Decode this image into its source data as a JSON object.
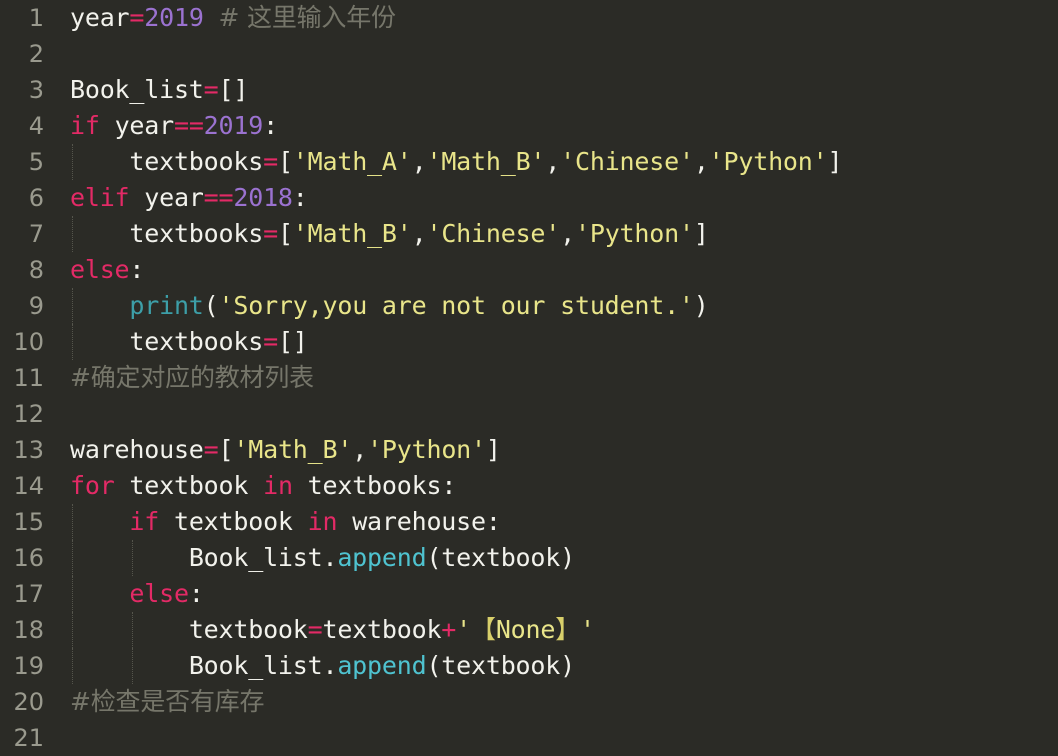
{
  "editor": {
    "language": "Python",
    "theme": "dark-olive",
    "colors": {
      "background": "#2b2b26",
      "foreground": "#f2f2ec",
      "gutter_text": "#9a9a8e",
      "keyword": "#e32a66",
      "operator": "#e32a66",
      "number": "#9b72d0",
      "string": "#e9e58a",
      "builtin_function": "#4fc3d0",
      "comment": "#76766a",
      "indent_guide": "#55554c",
      "fullwidth_bracket": "#d8cf6a"
    },
    "first_visible_line": 1,
    "last_visible_line": 21,
    "total_visible_lines": 21
  },
  "lines": [
    {
      "number": "1",
      "guides": 0,
      "text": "year=2019 # 这里输入年份"
    },
    {
      "number": "2",
      "guides": 0,
      "text": ""
    },
    {
      "number": "3",
      "guides": 0,
      "text": "Book_list=[]"
    },
    {
      "number": "4",
      "guides": 0,
      "text": "if year==2019:"
    },
    {
      "number": "5",
      "guides": 1,
      "text": "    textbooks=['Math_A','Math_B','Chinese','Python']"
    },
    {
      "number": "6",
      "guides": 0,
      "text": "elif year==2018:"
    },
    {
      "number": "7",
      "guides": 1,
      "text": "    textbooks=['Math_B','Chinese','Python']"
    },
    {
      "number": "8",
      "guides": 0,
      "text": "else:"
    },
    {
      "number": "9",
      "guides": 1,
      "text": "    print('Sorry,you are not our student.')"
    },
    {
      "number": "10",
      "guides": 1,
      "text": "    textbooks=[]"
    },
    {
      "number": "11",
      "guides": 0,
      "text": "#确定对应的教材列表"
    },
    {
      "number": "12",
      "guides": 0,
      "text": ""
    },
    {
      "number": "13",
      "guides": 0,
      "text": "warehouse=['Math_B','Python']"
    },
    {
      "number": "14",
      "guides": 0,
      "text": "for textbook in textbooks:"
    },
    {
      "number": "15",
      "guides": 1,
      "text": "    if textbook in warehouse:"
    },
    {
      "number": "16",
      "guides": 2,
      "text": "        Book_list.append(textbook)"
    },
    {
      "number": "17",
      "guides": 1,
      "text": "    else:"
    },
    {
      "number": "18",
      "guides": 2,
      "text": "        textbook=textbook+'【None】'"
    },
    {
      "number": "19",
      "guides": 2,
      "text": "        Book_list.append(textbook)"
    },
    {
      "number": "20",
      "guides": 0,
      "text": "#检查是否有库存"
    },
    {
      "number": "21",
      "guides": 0,
      "text": ""
    }
  ],
  "tokens": {
    "l1": {
      "name": "year",
      "eq": "=",
      "num": "2019",
      "comment": "# 这里输入年份"
    },
    "l3": {
      "name": "Book_list",
      "eq": "=",
      "brackets": "[]"
    },
    "l4": {
      "kw": "if",
      "name": "year",
      "op": "==",
      "num": "2019",
      "colon": ":"
    },
    "l5": {
      "name": "textbooks",
      "eq": "=",
      "open": "[",
      "s1": "'Math_A'",
      "c1": ",",
      "s2": "'Math_B'",
      "c2": ",",
      "s3": "'Chinese'",
      "c3": ",",
      "s4": "'Python'",
      "close": "]"
    },
    "l6": {
      "kw": "elif",
      "name": "year",
      "op": "==",
      "num": "2018",
      "colon": ":"
    },
    "l7": {
      "name": "textbooks",
      "eq": "=",
      "open": "[",
      "s1": "'Math_B'",
      "c1": ",",
      "s2": "'Chinese'",
      "c2": ",",
      "s3": "'Python'",
      "close": "]"
    },
    "l8": {
      "kw": "else",
      "colon": ":"
    },
    "l9": {
      "fn": "print",
      "open": "(",
      "str": "'Sorry,you are not our student.'",
      "close": ")"
    },
    "l10": {
      "name": "textbooks",
      "eq": "=",
      "brackets": "[]"
    },
    "l11": {
      "comment": "#确定对应的教材列表"
    },
    "l13": {
      "name": "warehouse",
      "eq": "=",
      "open": "[",
      "s1": "'Math_B'",
      "c1": ",",
      "s2": "'Python'",
      "close": "]"
    },
    "l14": {
      "kw1": "for",
      "name1": "textbook",
      "kw2": "in",
      "name2": "textbooks",
      "colon": ":"
    },
    "l15": {
      "kw1": "if",
      "name1": "textbook",
      "kw2": "in",
      "name2": "warehouse",
      "colon": ":"
    },
    "l16": {
      "obj": "Book_list.",
      "fn": "append",
      "open": "(",
      "arg": "textbook",
      "close": ")"
    },
    "l17": {
      "kw": "else",
      "colon": ":"
    },
    "l18": {
      "name1": "textbook",
      "eq": "=",
      "name2": "textbook",
      "plus": "+",
      "q1": "'",
      "lb": "【",
      "none": "None",
      "rb": "】",
      "q2": "'"
    },
    "l19": {
      "obj": "Book_list.",
      "fn": "append",
      "open": "(",
      "arg": "textbook",
      "close": ")"
    },
    "l20": {
      "comment": "#检查是否有库存"
    }
  }
}
